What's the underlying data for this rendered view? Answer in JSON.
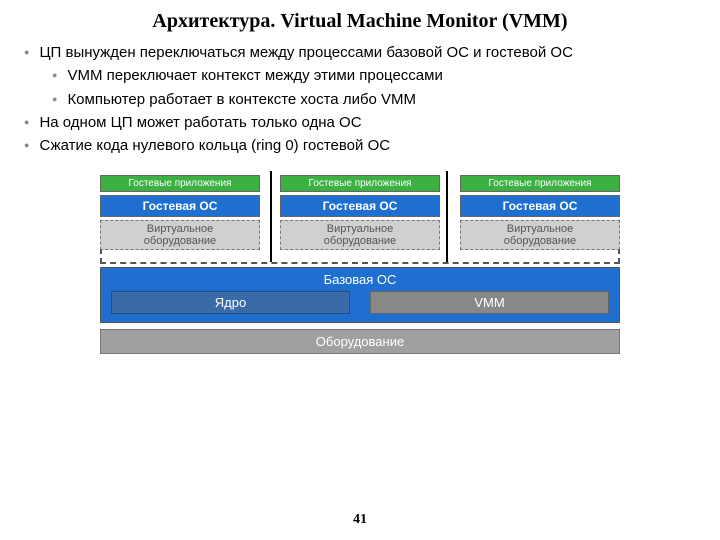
{
  "title": "Архитектура.  Virtual Machine Monitor (VMM)",
  "bullets": {
    "b1": "ЦП вынужден переключаться между процессами базовой ОС и гостевой ОС",
    "b1a": "VMM переключает контекст между этими процессами",
    "b1b": "Компьютер работает в контексте хоста либо VMM",
    "b2": "На одном ЦП может работать только одна ОС",
    "b3": "Сжатие кода нулевого кольца (ring 0) гостевой ОС"
  },
  "diagram": {
    "guest_apps": "Гостевые приложения",
    "guest_os": "Гостевая ОС",
    "virt_hw": "Виртуальное\nоборудование",
    "base_os": "Базовая ОС",
    "kernel": "Ядро",
    "vmm": "VMM",
    "hardware": "Оборудование"
  },
  "page_number": "41"
}
